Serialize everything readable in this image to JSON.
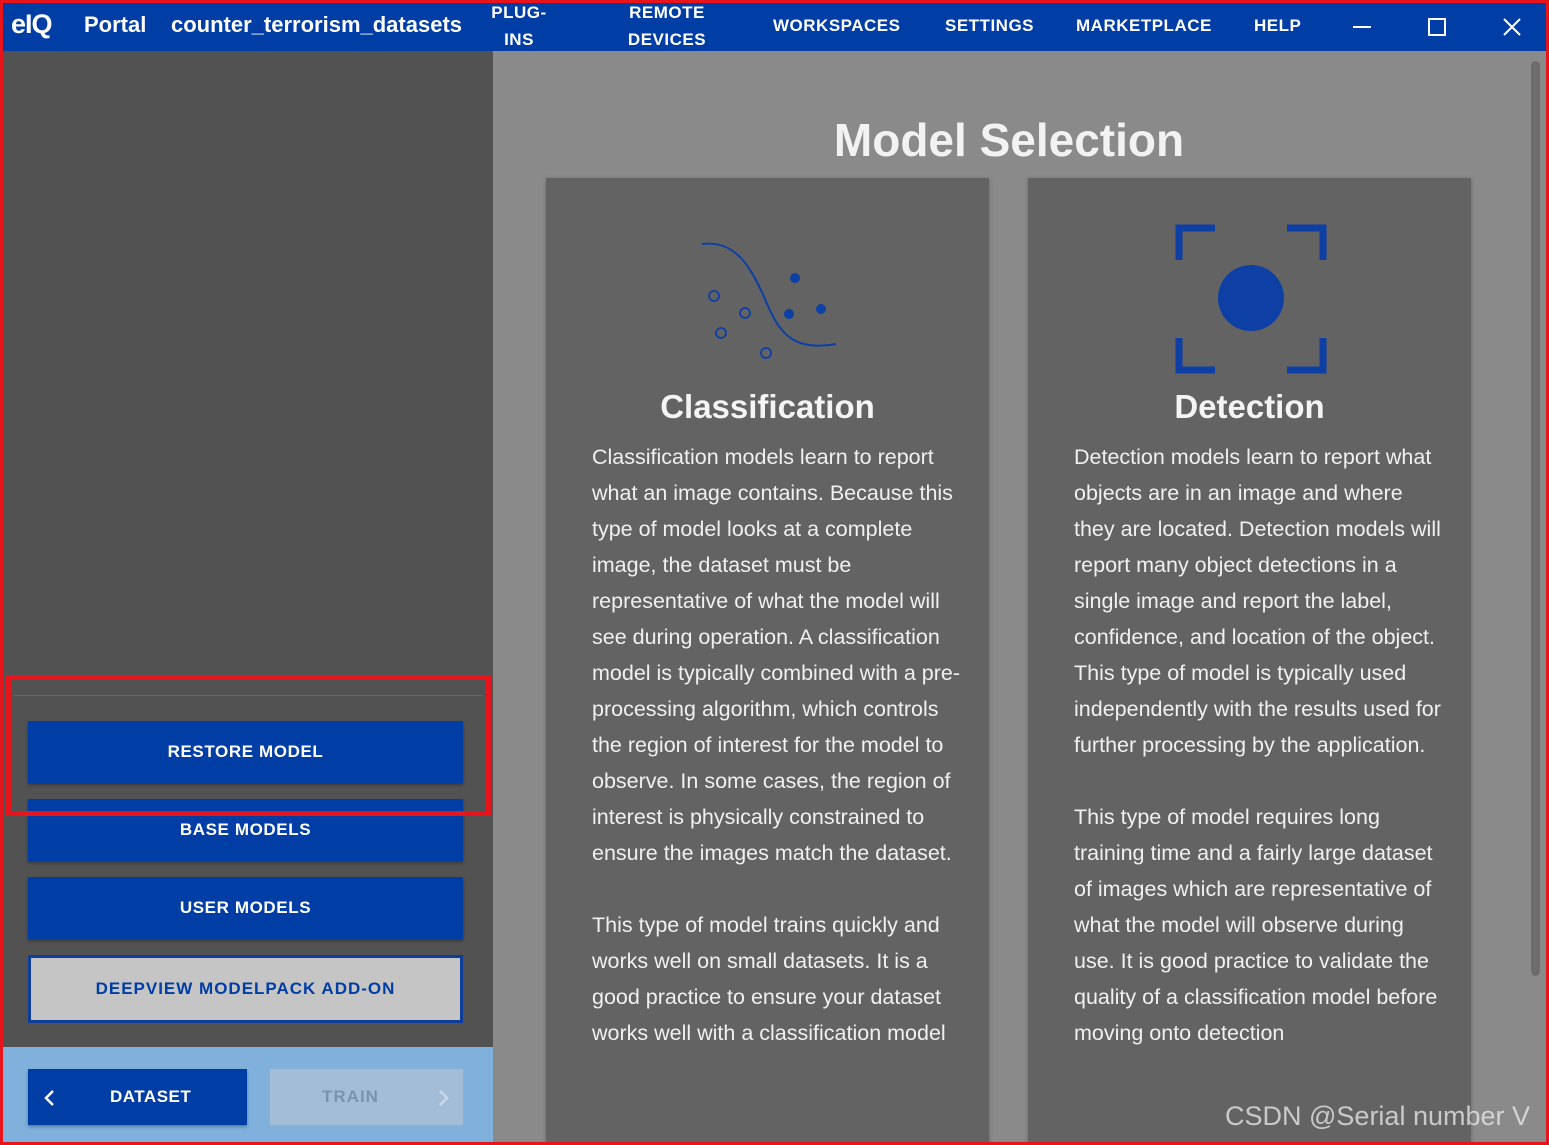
{
  "titlebar": {
    "logo": "eIQ",
    "app_name": "Portal",
    "workspace_name": "counter_terrorism_datasets",
    "nav": {
      "plugins": [
        "PLUG-",
        "INS"
      ],
      "remote_devices": [
        "REMOTE",
        "DEVICES"
      ],
      "workspaces": "WORKSPACES",
      "settings": "SETTINGS",
      "marketplace": "MARKETPLACE",
      "help": "HELP"
    },
    "window_controls": [
      "minimize-icon",
      "maximize-icon",
      "close-icon"
    ]
  },
  "sidebar": {
    "restore_model": "RESTORE MODEL",
    "base_models": "BASE MODELS",
    "user_models": "USER MODELS",
    "modelpack_addon": "DEEPVIEW MODELPACK ADD-ON",
    "nav_prev": "DATASET",
    "nav_next": "TRAIN"
  },
  "main": {
    "title": "Model Selection",
    "cards": [
      {
        "icon": "classification-curve-icon",
        "title": "Classification",
        "paragraphs": [
          "Classification models learn to report what an image contains. Because this type of model looks at a complete image, the dataset must be representative of what the model will see during operation. A classification model is typically combined with a pre-processing algorithm, which controls the region of interest for the model to observe. In some cases, the region of interest is physically constrained to ensure the images match the dataset.",
          "This type of model trains quickly and works well on small datasets. It is a good practice to ensure your dataset works well with a classification model"
        ]
      },
      {
        "icon": "detection-target-icon",
        "title": "Detection",
        "paragraphs": [
          "Detection models learn to report what objects are in an image and where they are located. Detection models will report many object detections in a single image and report the label, confidence, and location of the object. This type of model is typically used independently with the results used for further processing by the application.",
          "This type of model requires long training time and a fairly large dataset of images which are representative of what the model will observe during use. It is good practice to validate the quality of a classification model before moving onto detection"
        ]
      }
    ]
  },
  "watermark": "CSDN @Serial number V",
  "colors": {
    "accent_blue": "#003da5",
    "highlight_red": "#e8141b",
    "sidebar_bg": "#525252",
    "main_bg": "#8a8a8a",
    "card_bg": "#636363",
    "bottom_bar_bg": "#7fb1dc"
  }
}
